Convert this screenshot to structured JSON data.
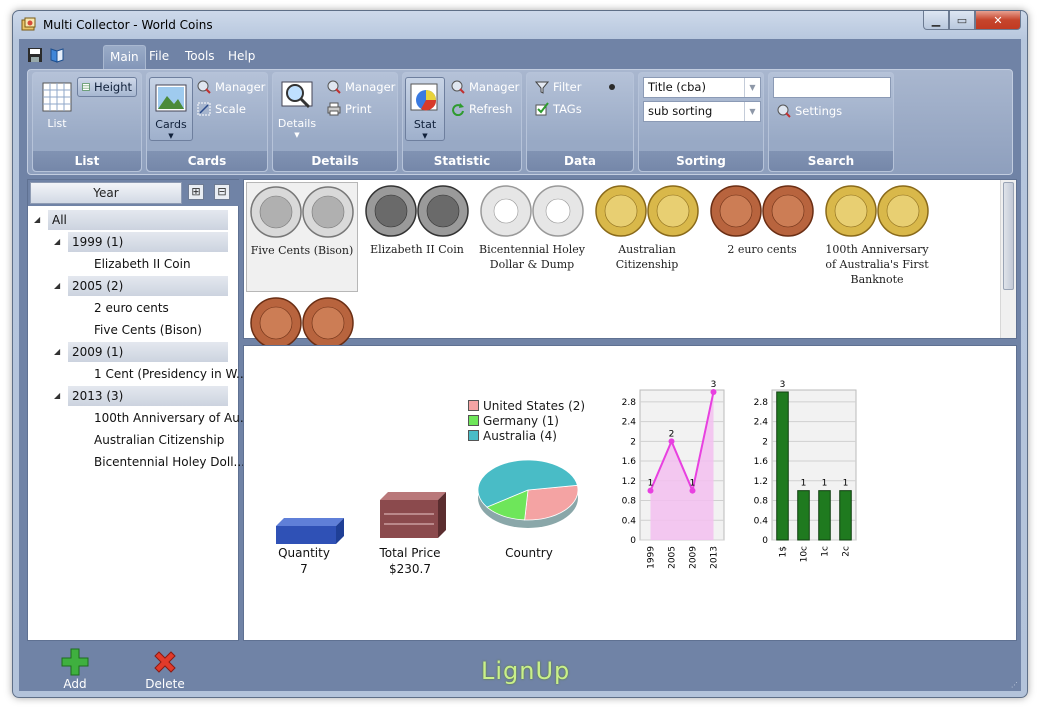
{
  "window": {
    "title": "Multi Collector - World Coins"
  },
  "menu": {
    "items": [
      "Main",
      "File",
      "Tools",
      "Help"
    ],
    "active": "Main"
  },
  "ribbon": {
    "list": {
      "list_label": "List",
      "height_label": "Height",
      "group_label": "List"
    },
    "cards": {
      "cards_label": "Cards",
      "manager_label": "Manager",
      "scale_label": "Scale",
      "group_label": "Cards"
    },
    "details": {
      "details_label": "Details",
      "manager_label": "Manager",
      "print_label": "Print",
      "group_label": "Details"
    },
    "statistic": {
      "stat_label": "Stat",
      "manager_label": "Manager",
      "refresh_label": "Refresh",
      "group_label": "Statistic"
    },
    "data": {
      "filter_label": "Filter",
      "tags_label": "TAGs",
      "group_label": "Data"
    },
    "sorting": {
      "primary_value": "Title (cba)",
      "secondary_value": "sub sorting",
      "group_label": "Sorting"
    },
    "search": {
      "settings_label": "Settings",
      "group_label": "Search",
      "value": ""
    }
  },
  "left_panel": {
    "header": "Year",
    "expand_symbol": "⊞",
    "collapse_symbol": "⊟",
    "tree": [
      {
        "label": "All",
        "kind": "root"
      },
      {
        "label": "1999 (1)",
        "kind": "group"
      },
      {
        "label": "Elizabeth II Coin",
        "kind": "item"
      },
      {
        "label": "2005 (2)",
        "kind": "group"
      },
      {
        "label": "2 euro cents",
        "kind": "item"
      },
      {
        "label": "Five Cents (Bison)",
        "kind": "item"
      },
      {
        "label": "2009 (1)",
        "kind": "group"
      },
      {
        "label": "1 Cent (Presidency in W...",
        "kind": "item"
      },
      {
        "label": "2013 (3)",
        "kind": "group"
      },
      {
        "label": "100th Anniversary of Au...",
        "kind": "item"
      },
      {
        "label": "Australian Citizenship",
        "kind": "item"
      },
      {
        "label": "Bicentennial Holey Doll...",
        "kind": "item"
      }
    ]
  },
  "cards": [
    {
      "caption": "Five Cents (Bison)",
      "metal": "silver",
      "selected": true
    },
    {
      "caption": "Elizabeth II Coin",
      "metal": "darksilver",
      "selected": false
    },
    {
      "caption": "Bicentennial Holey Dollar & Dump",
      "metal": "holey",
      "selected": false
    },
    {
      "caption": "Australian Citizenship",
      "metal": "gold",
      "selected": false
    },
    {
      "caption": "2 euro cents",
      "metal": "copper",
      "selected": false
    },
    {
      "caption": "100th Anniversary of Australia's First Banknote",
      "metal": "gold",
      "selected": false
    },
    {
      "caption": "",
      "metal": "copper",
      "selected": false
    }
  ],
  "stats": {
    "quantity_label": "Quantity",
    "quantity_value": "7",
    "price_label": "Total Price",
    "price_value": "$230.7",
    "country_label": "Country",
    "colors": {
      "us": "#f4a3a3",
      "de": "#6ee65a",
      "au": "#49bcc6",
      "line": "#e840e0",
      "bar": "#1f7a1f"
    }
  },
  "chart_data": [
    {
      "type": "pie",
      "title": "Country",
      "labels": [
        "United States (2)",
        "Germany (1)",
        "Australia (4)"
      ],
      "values": [
        2,
        1,
        4
      ]
    },
    {
      "type": "area",
      "categories": [
        "1999",
        "2005",
        "2009",
        "2013"
      ],
      "values": [
        1,
        2,
        1,
        3
      ],
      "data_labels": [
        "1",
        "2",
        "1",
        "3"
      ],
      "y_ticks": [
        "0",
        "0.4",
        "0.8",
        "1.2",
        "1.6",
        "2",
        "2.4",
        "2.8"
      ],
      "ylim": [
        0,
        3.04
      ],
      "grid": true
    },
    {
      "type": "bar",
      "categories": [
        "1$",
        "10c",
        "1c",
        "2c"
      ],
      "values": [
        3,
        1,
        1,
        1
      ],
      "data_labels": [
        "3",
        "1",
        "1",
        "1"
      ],
      "y_ticks": [
        "0",
        "0.4",
        "0.8",
        "1.2",
        "1.6",
        "2",
        "2.4",
        "2.8"
      ],
      "ylim": [
        0,
        3.04
      ],
      "grid": true
    }
  ],
  "bottom": {
    "add_label": "Add",
    "delete_label": "Delete",
    "logo_text": "LignUp"
  }
}
